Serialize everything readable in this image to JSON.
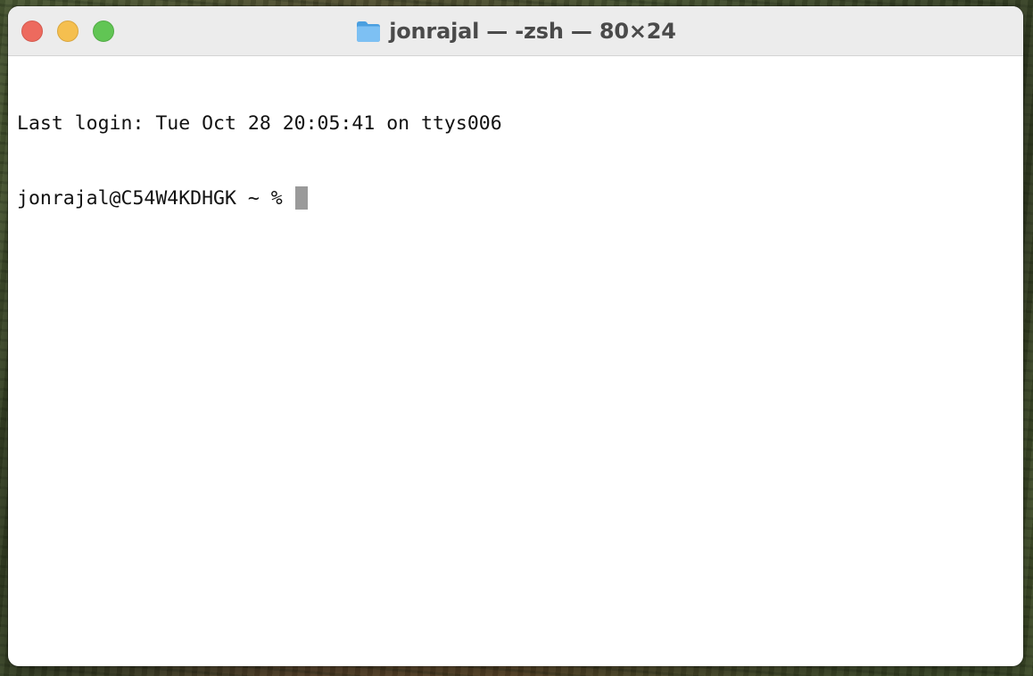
{
  "window": {
    "title": "jonrajal — -zsh — 80×24",
    "title_icon": "folder-icon",
    "traffic_lights": [
      {
        "name": "close",
        "color": "#ed6a5e"
      },
      {
        "name": "minimize",
        "color": "#f5bf4f"
      },
      {
        "name": "zoom",
        "color": "#61c554"
      }
    ]
  },
  "terminal": {
    "last_login": "Last login: Tue Oct 28 20:05:41 on ttys006",
    "prompt": "jonrajal@C54W4KDHGK ~ % ",
    "input": "",
    "cursor_color": "#9a9a9a"
  }
}
